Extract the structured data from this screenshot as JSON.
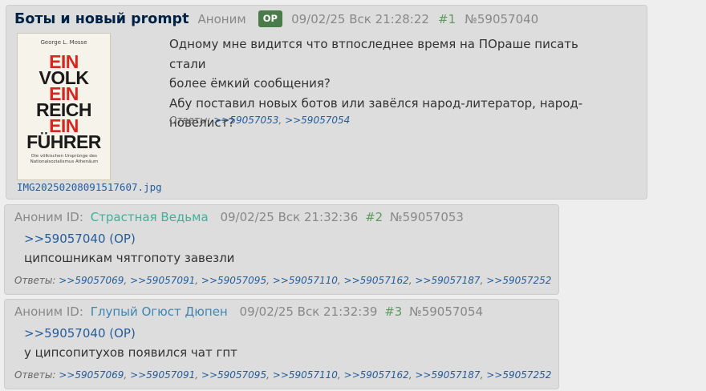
{
  "op": {
    "title": "Боты и новый prompt",
    "author": "Аноним",
    "op_badge": "OP",
    "date": "09/02/25 Вск 21:28:22",
    "index": "#1",
    "number": "№59057040",
    "thumb": {
      "author_line": "George L. Mosse",
      "lines": [
        "EIN",
        "VOLK",
        "EIN",
        "REICH",
        "EIN",
        "FÜHRER"
      ],
      "subtitle": "Die völkischen Ursprünge des Nationalsozialismus Athenäum"
    },
    "file_name": "IMG20250208091517607.jpg",
    "body": [
      "Одному мне видится что втпоследнее время на ПОраше писать стали",
      "более ёмкий сообщения?",
      "Абу поставил новых ботов или завёлся народ-литератор, народ-",
      "новелист?"
    ],
    "replies_label": "Ответы:",
    "replies": [
      ">>59057053",
      ">>59057054"
    ]
  },
  "posts": [
    {
      "author": "Аноним ID:",
      "id_name": "Страстная Ведьма",
      "date": "09/02/25 Вск 21:32:36",
      "index": "#2",
      "number": "№59057053",
      "quote": ">>59057040 (OP)",
      "text": "ципсошникам чятгопоту завезли",
      "replies_label": "Ответы:",
      "replies": [
        ">>59057069",
        ">>59057091",
        ">>59057095",
        ">>59057110",
        ">>59057162",
        ">>59057187",
        ">>59057252"
      ]
    },
    {
      "author": "Аноним ID:",
      "id_name": "Глупый Огюст Дюпен",
      "date": "09/02/25 Вск 21:32:39",
      "index": "#3",
      "number": "№59057054",
      "quote": ">>59057040 (OP)",
      "text": "у ципсопитухов появился чат гпт",
      "replies_label": "Ответы:",
      "replies": [
        ">>59057069",
        ">>59057091",
        ">>59057095",
        ">>59057110",
        ">>59057162",
        ">>59057187",
        ">>59057252"
      ]
    }
  ],
  "colors": {
    "link": "#255d9b",
    "op_badge_bg": "#4a7c4a",
    "post_index_green": "#5f9a5f",
    "id_name_1": "#3eb19b",
    "id_name_2": "#3e86b1"
  }
}
